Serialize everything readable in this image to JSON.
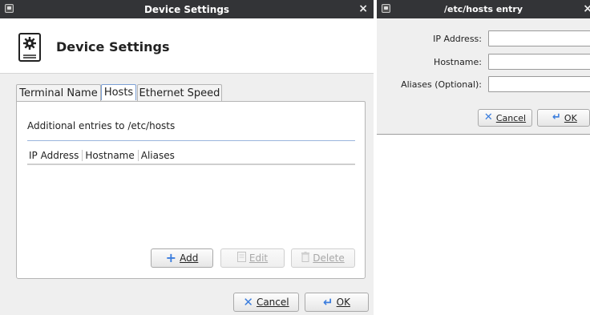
{
  "device_window": {
    "title": "Device Settings",
    "close_glyph": "×",
    "header_title": "Device Settings",
    "header_icon": "gear-document-icon",
    "tabs": [
      {
        "label": "Terminal Name"
      },
      {
        "label": "Hosts"
      },
      {
        "label": "Ethernet Speed"
      }
    ],
    "hosts_panel": {
      "description": "Additional entries to /etc/hosts",
      "columns": [
        "IP Address",
        "Hostname",
        "Aliases"
      ],
      "add_label": "Add",
      "edit_label": "Edit",
      "delete_label": "Delete"
    },
    "cancel_label": "Cancel",
    "ok_label": "OK"
  },
  "hosts_entry_window": {
    "title": "/etc/hosts entry",
    "fields": [
      {
        "label": "IP Address:",
        "value": ""
      },
      {
        "label": "Hostname:",
        "value": ""
      },
      {
        "label": "Aliases (Optional):",
        "value": ""
      }
    ],
    "cancel_label": "Cancel",
    "ok_label": "OK"
  },
  "colors": {
    "titlebar": "#333437",
    "cancel_icon": "#3b7ddd",
    "ok_icon": "#3b7ddd",
    "add_icon": "#3b7ddd",
    "active_tab_border": "#7c9fd4"
  }
}
